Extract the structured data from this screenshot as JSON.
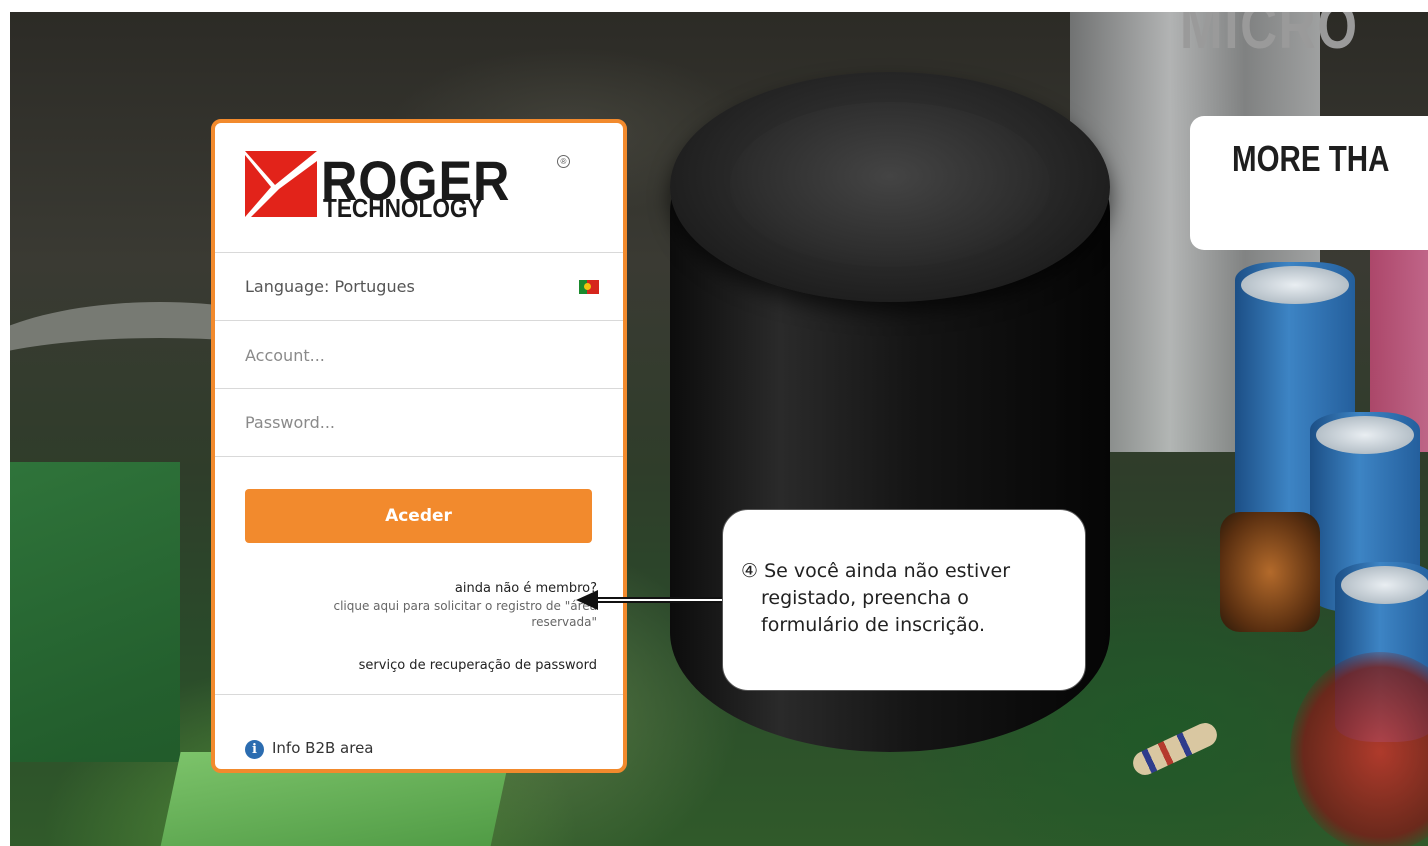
{
  "background": {
    "brand_text": "MICRO",
    "tagline": "MORE THA"
  },
  "login_card": {
    "logo": {
      "main": "ROGER",
      "sub": "TECHNOLOGY",
      "registered": "®"
    },
    "language_label": "Language: Portugues",
    "language_flag_icon": "portugal-flag-icon",
    "account_placeholder": "Account...",
    "password_placeholder": "Password...",
    "login_button": "Aceder",
    "member_question": "ainda não é membro?",
    "register_link": "clique aqui para solicitar o registro de \"área reservada\"",
    "password_recovery": "serviço de recuperação de password",
    "info_icon": "info-icon",
    "info_label": "Info B2B area"
  },
  "annotation": {
    "text": "④ Se você ainda não estiver registado, preencha o formulário de inscrição.",
    "arrow_icon": "left-arrow-icon"
  },
  "colors": {
    "accent": "#f28a2d",
    "logo_red": "#e2231a",
    "info_blue": "#2b6cb0"
  }
}
